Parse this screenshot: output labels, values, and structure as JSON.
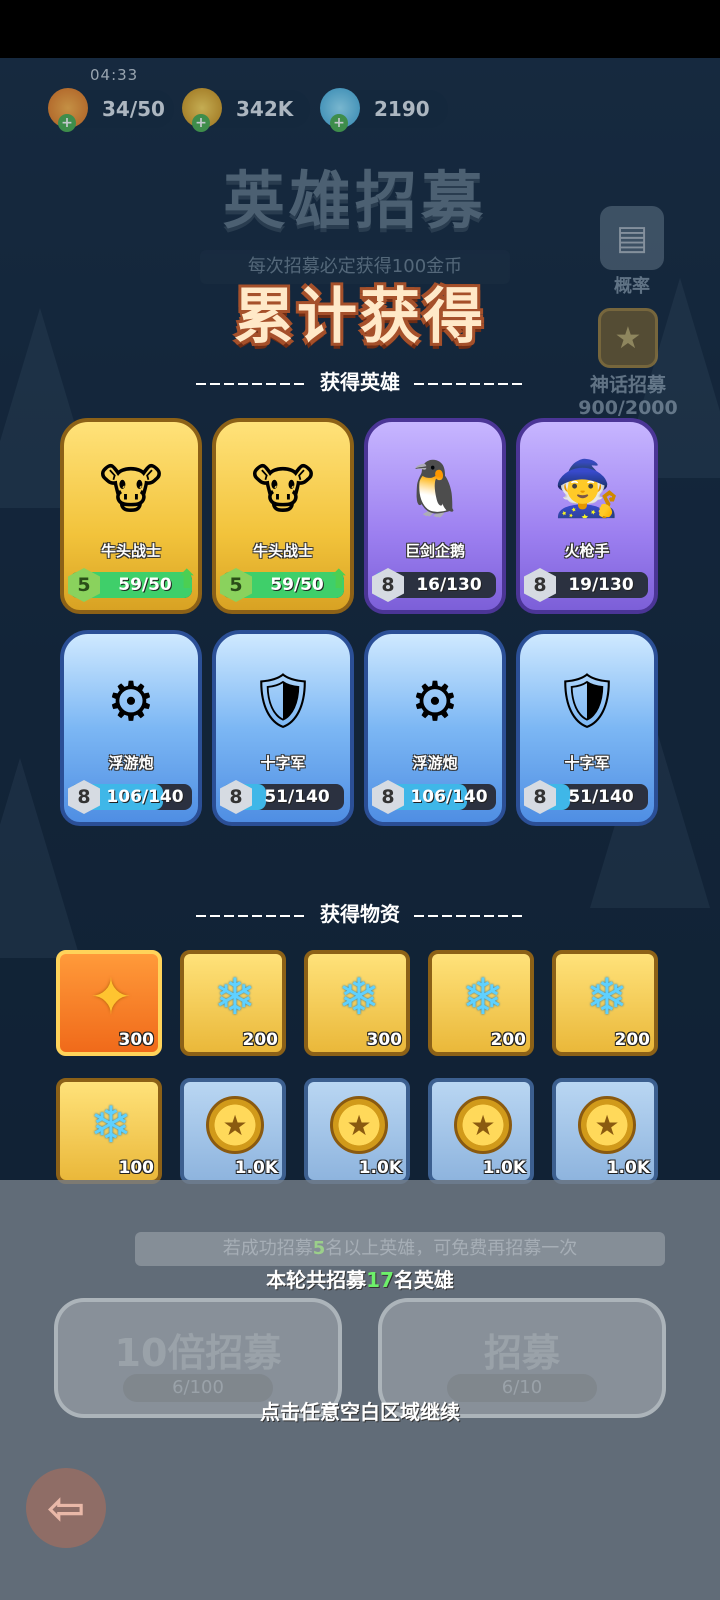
{
  "timer": "04:33",
  "resources": [
    {
      "icon": "energy-icon",
      "value": "34/50"
    },
    {
      "icon": "gold-coin-icon",
      "value": "342K"
    },
    {
      "icon": "snowflake-gem-icon",
      "value": "2190"
    }
  ],
  "background": {
    "title": "英雄招募",
    "subtitle": "每次招募必定获得100金币",
    "rate_label": "概率",
    "myth_label": "神话招募",
    "myth_progress": "900/2000"
  },
  "main_title": "累计获得",
  "heroes_header": "获得英雄",
  "heroes": [
    {
      "name": "牛头战士",
      "level": "5",
      "progress": "59/50",
      "progress_fraction": 1.0,
      "rarity": "gold",
      "icon": "minotaur-icon",
      "upgrade": true
    },
    {
      "name": "牛头战士",
      "level": "5",
      "progress": "59/50",
      "progress_fraction": 1.0,
      "rarity": "gold",
      "icon": "minotaur-icon",
      "upgrade": true
    },
    {
      "name": "巨剑企鹅",
      "level": "8",
      "progress": "16/130",
      "progress_fraction": 0.12,
      "rarity": "purple",
      "icon": "penguin-icon",
      "upgrade": false
    },
    {
      "name": "火枪手",
      "level": "8",
      "progress": "19/130",
      "progress_fraction": 0.15,
      "rarity": "purple",
      "icon": "musketeer-icon",
      "upgrade": false
    },
    {
      "name": "浮游炮",
      "level": "8",
      "progress": "106/140",
      "progress_fraction": 0.76,
      "rarity": "blue",
      "icon": "cannon-icon",
      "upgrade": false
    },
    {
      "name": "十字军",
      "level": "8",
      "progress": "51/140",
      "progress_fraction": 0.36,
      "rarity": "blue",
      "icon": "knight-icon",
      "upgrade": false
    },
    {
      "name": "浮游炮",
      "level": "8",
      "progress": "106/140",
      "progress_fraction": 0.76,
      "rarity": "blue",
      "icon": "cannon-icon",
      "upgrade": false
    },
    {
      "name": "十字军",
      "level": "8",
      "progress": "51/140",
      "progress_fraction": 0.36,
      "rarity": "blue",
      "icon": "knight-icon",
      "upgrade": false
    }
  ],
  "items_header": "获得物资",
  "items": [
    {
      "icon": "orange-crystal-icon",
      "amount": "300",
      "rarity": "orange"
    },
    {
      "icon": "snowflake-gem-icon",
      "amount": "200",
      "rarity": "gold"
    },
    {
      "icon": "snowflake-gem-icon",
      "amount": "300",
      "rarity": "gold"
    },
    {
      "icon": "snowflake-gem-icon",
      "amount": "200",
      "rarity": "gold"
    },
    {
      "icon": "snowflake-gem-icon",
      "amount": "200",
      "rarity": "gold"
    },
    {
      "icon": "snowflake-gem-icon",
      "amount": "100",
      "rarity": "gold"
    },
    {
      "icon": "gold-coin-icon",
      "amount": "1.0K",
      "rarity": "blue"
    },
    {
      "icon": "gold-coin-icon",
      "amount": "1.0K",
      "rarity": "blue"
    },
    {
      "icon": "gold-coin-icon",
      "amount": "1.0K",
      "rarity": "blue"
    },
    {
      "icon": "gold-coin-icon",
      "amount": "1.0K",
      "rarity": "blue"
    }
  ],
  "bottom": {
    "tip_prefix": "若成功招募",
    "tip_count": "5",
    "tip_suffix": "名以上英雄，可免费再招募一次",
    "total_prefix": "本轮共招募",
    "total_count": "17",
    "total_suffix": "名英雄",
    "ten_label": "10倍招募",
    "ten_count": "6/100",
    "single_label": "招募",
    "single_count": "6/10",
    "continue_text": "点击任意空白区域继续"
  },
  "colors": {
    "gold": "#f2c33b",
    "purple": "#9c7ff0",
    "blue": "#7cb7f4",
    "green_bar": "#3fcf6a",
    "blue_bar": "#3fb7e8"
  }
}
